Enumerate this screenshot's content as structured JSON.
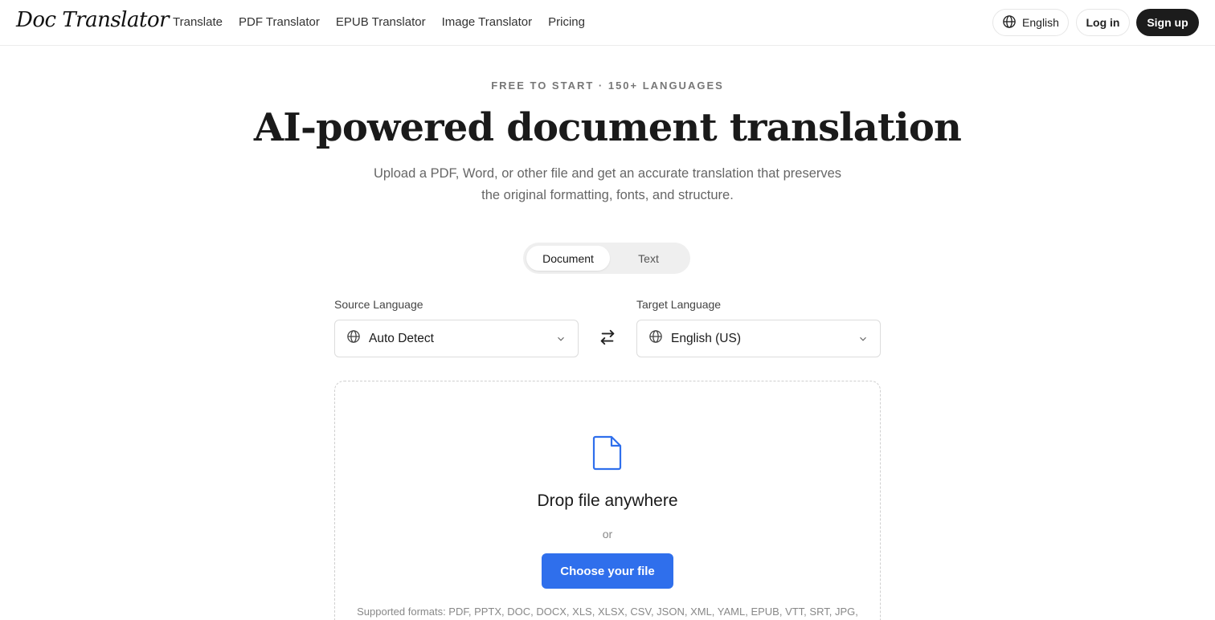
{
  "navbar": {
    "logo": "Doc Translator",
    "links": [
      "Translate",
      "PDF Translator",
      "EPUB Translator",
      "Image Translator",
      "Pricing"
    ],
    "language": "English",
    "login": "Log in",
    "signup": "Sign up"
  },
  "hero": {
    "eyebrow": "FREE TO START · 150+ LANGUAGES",
    "headline": "AI-powered document translation",
    "subline_1": "Upload a PDF, Word, or other file and get an accurate translation that preserves",
    "subline_2": "the original formatting, fonts, and structure."
  },
  "mode_toggle": {
    "options": [
      "Document",
      "Text"
    ],
    "selected": "Document"
  },
  "source": {
    "label": "Source Language",
    "value": "Auto Detect"
  },
  "target": {
    "label": "Target Language",
    "value": "English (US)"
  },
  "dropzone": {
    "title": "Drop file anywhere",
    "or": "or",
    "button": "Choose your file",
    "formats": "Supported formats: PDF, PPTX, DOC, DOCX, XLS, XLSX, CSV, JSON, XML, YAML, EPUB, VTT, SRT, JPG,"
  },
  "icons": {
    "globe": "globe-icon",
    "chevron": "chevron-down-icon",
    "swap": "swap-arrows-icon",
    "file": "file-icon"
  },
  "colors": {
    "accent": "#2f6fec",
    "signup_bg": "#1c1c1c",
    "toggle_bg": "#efefef"
  }
}
